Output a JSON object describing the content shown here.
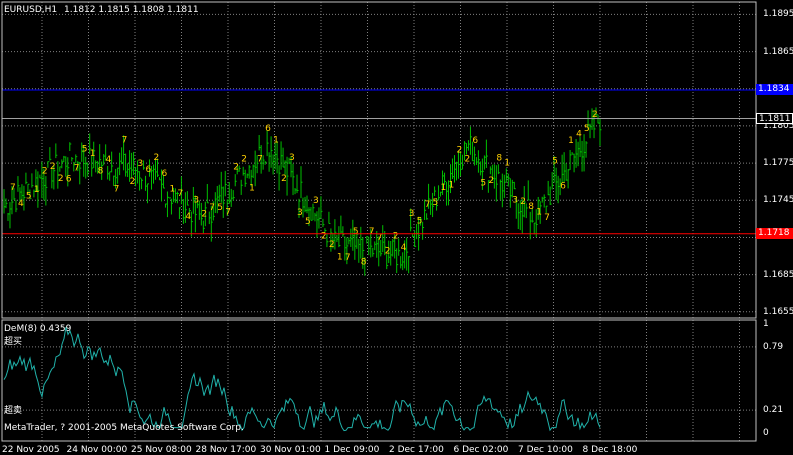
{
  "header": {
    "symbol": "EURUSD,H1",
    "ohlc": "1.1812 1.1815 1.1808 1.1811"
  },
  "price_axis": [
    "1.1895",
    "1.1865",
    "1.1835",
    "1.1805",
    "1.1775",
    "1.1745",
    "1.1715",
    "1.1685",
    "1.1655"
  ],
  "price_tags": {
    "blue": {
      "text": "1.1834",
      "color": "#0000ff"
    },
    "current": {
      "text": "1.1811",
      "color": "#000000"
    },
    "red": {
      "text": "1.1718",
      "color": "#ff0000"
    }
  },
  "indicator": {
    "title": "DeM(8) 0.4359",
    "upper_label": "超买",
    "lower_label": "超卖",
    "axis": [
      "1",
      "0.79",
      "0.21",
      "0"
    ],
    "color": "#20b2aa"
  },
  "copyright": "MetaTrader, ? 2001-2005 MetaQuotes Software Corp.",
  "time_axis": [
    "22 Nov 2005",
    "24 Nov 00:00",
    "25 Nov 08:00",
    "28 Nov 17:00",
    "30 Nov 01:00",
    "1 Dec 09:00",
    "2 Dec 17:00",
    "6 Dec 02:00",
    "7 Dec 10:00",
    "8 Dec 18:00"
  ],
  "colors": {
    "bars": "#00c000",
    "grid": "#808080",
    "markers": "#ffd000",
    "axis_line": "#c0c0c0"
  },
  "chart_data": {
    "type": "line",
    "title": "EURUSD,H1",
    "ylim": [
      1.165,
      1.1905
    ],
    "x": [
      "22 Nov 2005",
      "24 Nov 00:00",
      "25 Nov 08:00",
      "28 Nov 17:00",
      "30 Nov 01:00",
      "1 Dec 09:00",
      "2 Dec 17:00",
      "6 Dec 02:00",
      "7 Dec 10:00",
      "8 Dec 18:00"
    ],
    "series": [
      {
        "values": [
          1.174,
          1.178,
          1.177,
          1.173,
          1.179,
          1.171,
          1.17,
          1.179,
          1.173,
          1.1811
        ]
      }
    ],
    "horizontal_levels": [
      1.1834,
      1.1811,
      1.1718
    ],
    "indicator": {
      "name": "DeM(8)",
      "last": 0.4359,
      "levels": [
        0.21,
        0.79
      ],
      "ylim": [
        0,
        1
      ]
    },
    "grid": true
  }
}
